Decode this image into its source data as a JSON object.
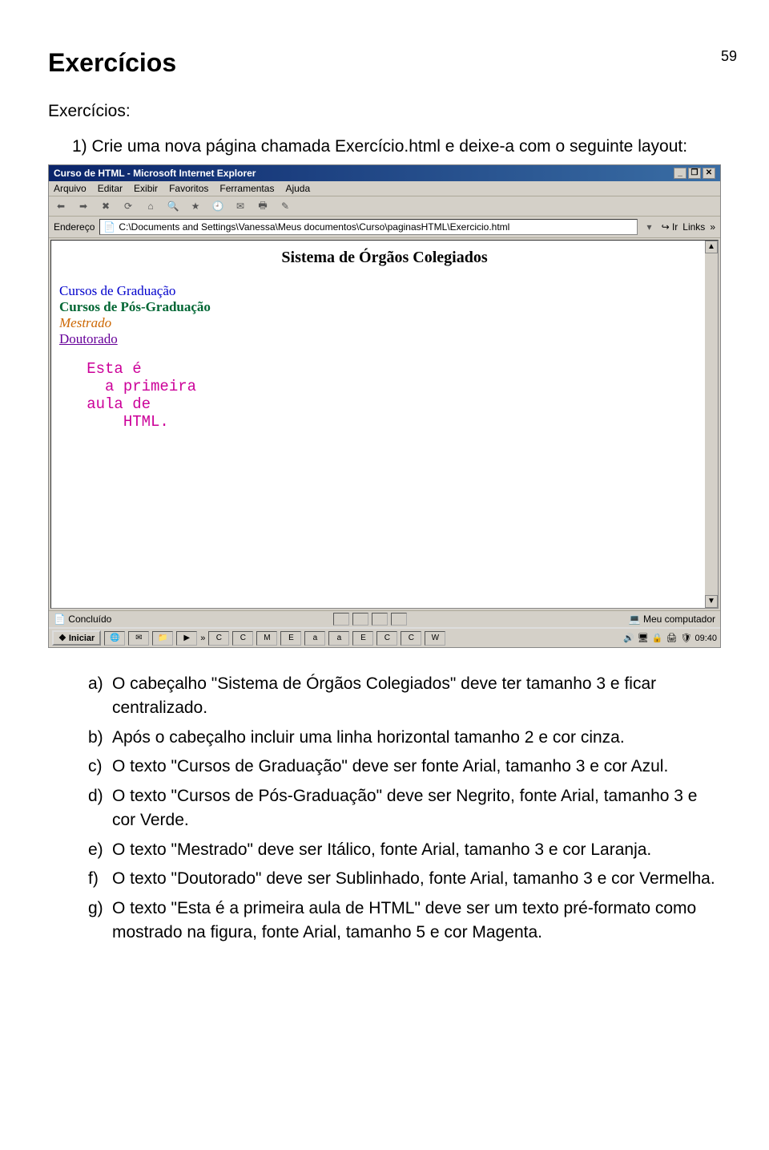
{
  "pagenum": "59",
  "title": "Exercícios",
  "subtitle": "Exercícios:",
  "question1": "1)  Crie uma nova página chamada Exercício.html e deixe-a com o seguinte layout:",
  "browser": {
    "title": "Curso de HTML - Microsoft Internet Explorer",
    "menu": [
      "Arquivo",
      "Editar",
      "Exibir",
      "Favoritos",
      "Ferramentas",
      "Ajuda"
    ],
    "addr_label": "Endereço",
    "addr_value": "C:\\Documents and Settings\\Vanessa\\Meus documentos\\Curso\\paginasHTML\\Exercicio.html",
    "go_label": "Ir",
    "links_label": "Links",
    "content": {
      "heading": "Sistema de Órgãos Colegiados",
      "line_blue": "Cursos de Graduação",
      "line_green": "Cursos de Pós-Graduação",
      "line_orange": "Mestrado",
      "line_purple": "Doutorado",
      "pre1": "   Esta é",
      "pre2": "     a primeira",
      "pre3": "   aula de",
      "pre4": "       HTML."
    },
    "status_left": "Concluído",
    "status_right": "Meu computador",
    "start": "Iniciar",
    "clock": "09:40"
  },
  "items": {
    "a": {
      "lbl": "a)",
      "txt": "O cabeçalho \"Sistema de Órgãos Colegiados\" deve ter tamanho 3 e ficar centralizado."
    },
    "b": {
      "lbl": "b)",
      "txt": "Após o cabeçalho incluir uma linha horizontal tamanho 2 e cor cinza."
    },
    "c": {
      "lbl": "c)",
      "txt": "O texto \"Cursos de Graduação\" deve ser fonte Arial, tamanho 3 e cor Azul."
    },
    "d": {
      "lbl": "d)",
      "txt": "O texto \"Cursos de Pós-Graduação\" deve ser Negrito, fonte Arial, tamanho 3 e cor Verde."
    },
    "e": {
      "lbl": "e)",
      "txt": "O texto \"Mestrado\" deve ser Itálico, fonte Arial, tamanho 3 e cor Laranja."
    },
    "f": {
      "lbl": "f)",
      "txt": "O texto \"Doutorado\" deve ser Sublinhado, fonte Arial, tamanho 3 e cor Vermelha."
    },
    "g": {
      "lbl": "g)",
      "txt": "O texto \"Esta é a primeira aula de HTML\" deve ser um texto pré-formato como mostrado na figura, fonte Arial, tamanho 5 e cor Magenta."
    }
  }
}
